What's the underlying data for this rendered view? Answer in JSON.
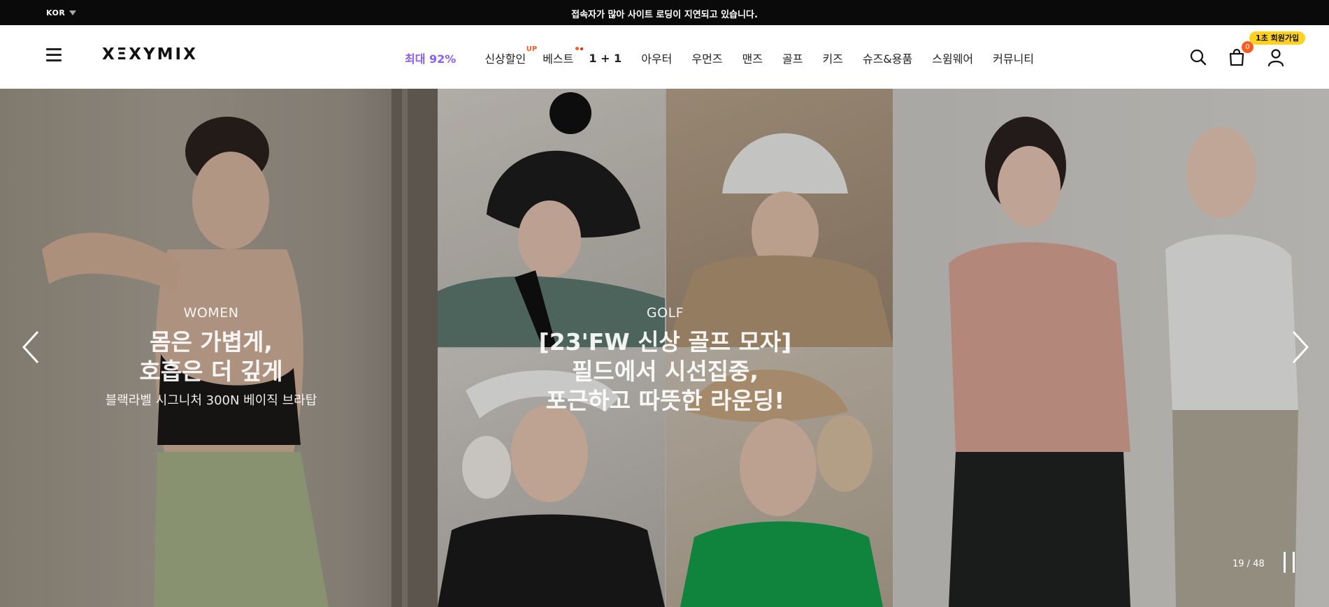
{
  "topbar": {
    "language": "KOR",
    "notice": "접속자가 많아 사이트 로딩이 지연되고 있습니다."
  },
  "header": {
    "logo": "XΞXYMIX",
    "nav": [
      {
        "label": "최대 92%",
        "style": "highlight",
        "color": "#8b5cf6"
      },
      {
        "label": "신상할인",
        "up": "UP"
      },
      {
        "label": "베스트"
      },
      {
        "label": "1 + 1"
      },
      {
        "label": "아우터"
      },
      {
        "label": "우먼즈"
      },
      {
        "label": "맨즈"
      },
      {
        "label": "골프"
      },
      {
        "label": "키즈"
      },
      {
        "label": "슈즈&용품"
      },
      {
        "label": "스윔웨어"
      },
      {
        "label": "커뮤니티"
      }
    ],
    "join_badge": "1초 회원가입",
    "cart_count": "0",
    "icons": [
      "menu-icon",
      "search-icon",
      "cart-icon",
      "user-icon"
    ]
  },
  "hero": {
    "slides": [
      {
        "tag": "WOMEN",
        "title_lines": [
          "몸은 가볍게,",
          "호흡은 더 깊게"
        ],
        "subtitle": "블랙라벨 시그니처 300N 베이직 브라탑"
      },
      {
        "tag": "GOLF",
        "title_lines": [
          "[23'FW 신상 골프 모자]",
          "필드에서 시선집중,",
          "포근하고 따뜻한 라운딩!"
        ],
        "subtitle": ""
      }
    ],
    "pager": "19 / 48",
    "accent_colors": {
      "cart_badge": "#ff5a1f",
      "join_badge": "#ffd21f"
    }
  }
}
